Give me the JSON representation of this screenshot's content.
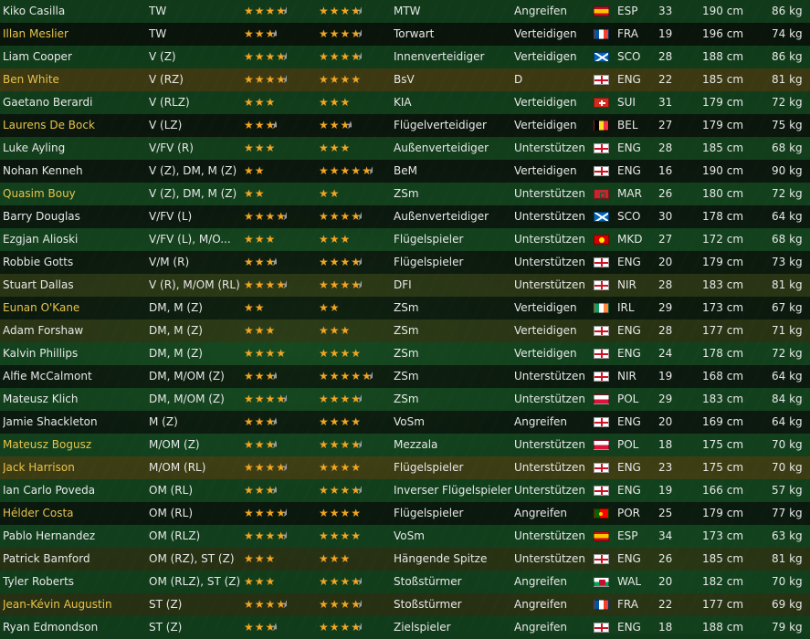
{
  "colors": {
    "star": "#f2a623",
    "star_empty": "#9a9a9a",
    "highlight_name": "#e8c24a",
    "text": "#e8e8e8"
  },
  "players": [
    {
      "name": "Kiko Casilla",
      "highlight": false,
      "pos": "TW",
      "ca": 3.5,
      "pa": 3.5,
      "role": "MTW",
      "duty": "Angreifen",
      "flag": "ESP",
      "nat": "ESP",
      "age": "33",
      "height": "190 cm",
      "weight": "86 kg",
      "row": "r-green"
    },
    {
      "name": "Illan Meslier",
      "highlight": true,
      "pos": "TW",
      "ca": 2.5,
      "pa": 3.5,
      "role": "Torwart",
      "duty": "Verteidigen",
      "flag": "FRA",
      "nat": "FRA",
      "age": "19",
      "height": "196 cm",
      "weight": "74 kg",
      "row": "r-dark"
    },
    {
      "name": "Liam Cooper",
      "highlight": false,
      "pos": "V (Z)",
      "ca": 3.5,
      "pa": 3.5,
      "role": "Innenverteidiger",
      "duty": "Verteidigen",
      "flag": "SCO",
      "nat": "SCO",
      "age": "28",
      "height": "188 cm",
      "weight": "86 kg",
      "row": "r-green"
    },
    {
      "name": "Ben White",
      "highlight": true,
      "pos": "V (RZ)",
      "ca": 3.5,
      "pa": 4,
      "role": "BsV",
      "duty": "D",
      "flag": "ENG",
      "nat": "ENG",
      "age": "22",
      "height": "185 cm",
      "weight": "81 kg",
      "row": "r-gold"
    },
    {
      "name": "Gaetano Berardi",
      "highlight": false,
      "pos": "V (RLZ)",
      "ca": 3,
      "pa": 3,
      "role": "KIA",
      "duty": "Verteidigen",
      "flag": "SUI",
      "nat": "SUI",
      "age": "31",
      "height": "179 cm",
      "weight": "72 kg",
      "row": "r-green"
    },
    {
      "name": "Laurens De Bock",
      "highlight": true,
      "pos": "V (LZ)",
      "ca": 2.5,
      "pa": 2.5,
      "role": "Flügelverteidiger",
      "duty": "Verteidigen",
      "flag": "BEL",
      "nat": "BEL",
      "age": "27",
      "height": "179 cm",
      "weight": "75 kg",
      "row": "r-dark"
    },
    {
      "name": "Luke Ayling",
      "highlight": false,
      "pos": "V/FV (R)",
      "ca": 3,
      "pa": 3,
      "role": "Außenverteidiger",
      "duty": "Unterstützen",
      "flag": "ENG",
      "nat": "ENG",
      "age": "28",
      "height": "185 cm",
      "weight": "68 kg",
      "row": "r-green"
    },
    {
      "name": "Nohan Kenneh",
      "highlight": false,
      "pos": "V (Z), DM, M (Z)",
      "ca": 2,
      "pa": 4.5,
      "role": "BeM",
      "duty": "Verteidigen",
      "flag": "ENG",
      "nat": "ENG",
      "age": "16",
      "height": "190 cm",
      "weight": "90 kg",
      "row": "r-dark"
    },
    {
      "name": "Quasim Bouy",
      "highlight": true,
      "pos": "V (Z), DM, M (Z)",
      "ca": 2,
      "pa": 2,
      "role": "ZSm",
      "duty": "Unterstützen",
      "flag": "MAR",
      "nat": "MAR",
      "age": "26",
      "height": "180 cm",
      "weight": "72 kg",
      "row": "r-green"
    },
    {
      "name": "Barry Douglas",
      "highlight": false,
      "pos": "V/FV (L)",
      "ca": 3.5,
      "pa": 3.5,
      "role": "Außenverteidiger",
      "duty": "Unterstützen",
      "flag": "SCO",
      "nat": "SCO",
      "age": "30",
      "height": "178 cm",
      "weight": "64 kg",
      "row": "r-dark"
    },
    {
      "name": "Ezgjan Alioski",
      "highlight": false,
      "pos": "V/FV (L), M/O...",
      "ca": 3,
      "pa": 3,
      "role": "Flügelspieler",
      "duty": "Unterstützen",
      "flag": "MKD",
      "nat": "MKD",
      "age": "27",
      "height": "172 cm",
      "weight": "68 kg",
      "row": "r-green"
    },
    {
      "name": "Robbie Gotts",
      "highlight": false,
      "pos": "V/M (R)",
      "ca": 2.5,
      "pa": 3.5,
      "role": "Flügelspieler",
      "duty": "Unterstützen",
      "flag": "ENG",
      "nat": "ENG",
      "age": "20",
      "height": "179 cm",
      "weight": "73 kg",
      "row": "r-dark"
    },
    {
      "name": "Stuart Dallas",
      "highlight": false,
      "pos": "V (R), M/OM (RL)",
      "ca": 3.5,
      "pa": 3.5,
      "role": "DFI",
      "duty": "Unterstützen",
      "flag": "NIR",
      "nat": "NIR",
      "age": "28",
      "height": "183 cm",
      "weight": "81 kg",
      "row": "r-olive"
    },
    {
      "name": "Eunan O'Kane",
      "highlight": true,
      "pos": "DM, M (Z)",
      "ca": 2,
      "pa": 2,
      "role": "ZSm",
      "duty": "Verteidigen",
      "flag": "IRL",
      "nat": "IRL",
      "age": "29",
      "height": "173 cm",
      "weight": "67 kg",
      "row": "r-dark"
    },
    {
      "name": "Adam Forshaw",
      "highlight": false,
      "pos": "DM, M (Z)",
      "ca": 3,
      "pa": 3,
      "role": "ZSm",
      "duty": "Verteidigen",
      "flag": "ENG",
      "nat": "ENG",
      "age": "28",
      "height": "177 cm",
      "weight": "71 kg",
      "row": "r-olive"
    },
    {
      "name": "Kalvin Phillips",
      "highlight": false,
      "pos": "DM, M (Z)",
      "ca": 4,
      "pa": 4,
      "role": "ZSm",
      "duty": "Verteidigen",
      "flag": "ENG",
      "nat": "ENG",
      "age": "24",
      "height": "178 cm",
      "weight": "72 kg",
      "row": "r-green"
    },
    {
      "name": "Alfie McCalmont",
      "highlight": false,
      "pos": "DM, M/OM (Z)",
      "ca": 2.5,
      "pa": 4.5,
      "role": "ZSm",
      "duty": "Unterstützen",
      "flag": "NIR",
      "nat": "NIR",
      "age": "19",
      "height": "168 cm",
      "weight": "64 kg",
      "row": "r-dark"
    },
    {
      "name": "Mateusz Klich",
      "highlight": false,
      "pos": "DM, M/OM (Z)",
      "ca": 3.5,
      "pa": 3.5,
      "role": "ZSm",
      "duty": "Unterstützen",
      "flag": "POL",
      "nat": "POL",
      "age": "29",
      "height": "183 cm",
      "weight": "84 kg",
      "row": "r-green"
    },
    {
      "name": "Jamie Shackleton",
      "highlight": false,
      "pos": "M (Z)",
      "ca": 2.5,
      "pa": 4,
      "role": "VoSm",
      "duty": "Angreifen",
      "flag": "ENG",
      "nat": "ENG",
      "age": "20",
      "height": "169 cm",
      "weight": "64 kg",
      "row": "r-dark"
    },
    {
      "name": "Mateusz Bogusz",
      "highlight": true,
      "pos": "M/OM (Z)",
      "ca": 2.5,
      "pa": 3.5,
      "role": "Mezzala",
      "duty": "Unterstützen",
      "flag": "POL",
      "nat": "POL",
      "age": "18",
      "height": "175 cm",
      "weight": "70 kg",
      "row": "r-green"
    },
    {
      "name": "Jack Harrison",
      "highlight": true,
      "pos": "M/OM (RL)",
      "ca": 3.5,
      "pa": 4,
      "role": "Flügelspieler",
      "duty": "Unterstützen",
      "flag": "ENG",
      "nat": "ENG",
      "age": "23",
      "height": "175 cm",
      "weight": "70 kg",
      "row": "r-gold"
    },
    {
      "name": "Ian Carlo Poveda",
      "highlight": false,
      "pos": "OM (RL)",
      "ca": 2.5,
      "pa": 3.5,
      "role": "Inverser Flügelspieler",
      "duty": "Unterstützen",
      "flag": "ENG",
      "nat": "ENG",
      "age": "19",
      "height": "166 cm",
      "weight": "57 kg",
      "row": "r-green"
    },
    {
      "name": "Hélder Costa",
      "highlight": true,
      "pos": "OM (RL)",
      "ca": 3.5,
      "pa": 4,
      "role": "Flügelspieler",
      "duty": "Angreifen",
      "flag": "POR",
      "nat": "POR",
      "age": "25",
      "height": "179 cm",
      "weight": "77 kg",
      "row": "r-dark"
    },
    {
      "name": "Pablo Hernandez",
      "highlight": false,
      "pos": "OM (RLZ)",
      "ca": 3.5,
      "pa": 4,
      "role": "VoSm",
      "duty": "Unterstützen",
      "flag": "ESP",
      "nat": "ESP",
      "age": "34",
      "height": "173 cm",
      "weight": "63 kg",
      "row": "r-green"
    },
    {
      "name": "Patrick Bamford",
      "highlight": false,
      "pos": "OM (RZ), ST (Z)",
      "ca": 3,
      "pa": 3,
      "role": "Hängende Spitze",
      "duty": "Unterstützen",
      "flag": "ENG",
      "nat": "ENG",
      "age": "26",
      "height": "185 cm",
      "weight": "81 kg",
      "row": "r-olive"
    },
    {
      "name": "Tyler Roberts",
      "highlight": false,
      "pos": "OM (RLZ), ST (Z)",
      "ca": 3,
      "pa": 3.5,
      "role": "Stoßstürmer",
      "duty": "Angreifen",
      "flag": "WAL",
      "nat": "WAL",
      "age": "20",
      "height": "182 cm",
      "weight": "70 kg",
      "row": "r-green"
    },
    {
      "name": "Jean-Kévin Augustin",
      "highlight": true,
      "pos": "ST (Z)",
      "ca": 3.5,
      "pa": 3.5,
      "role": "Stoßstürmer",
      "duty": "Angreifen",
      "flag": "FRA",
      "nat": "FRA",
      "age": "22",
      "height": "177 cm",
      "weight": "69 kg",
      "row": "r-olive"
    },
    {
      "name": "Ryan Edmondson",
      "highlight": false,
      "pos": "ST (Z)",
      "ca": 2.5,
      "pa": 3.5,
      "role": "Zielspieler",
      "duty": "Angreifen",
      "flag": "ENG",
      "nat": "ENG",
      "age": "18",
      "height": "188 cm",
      "weight": "79 kg",
      "row": "r-green"
    }
  ]
}
